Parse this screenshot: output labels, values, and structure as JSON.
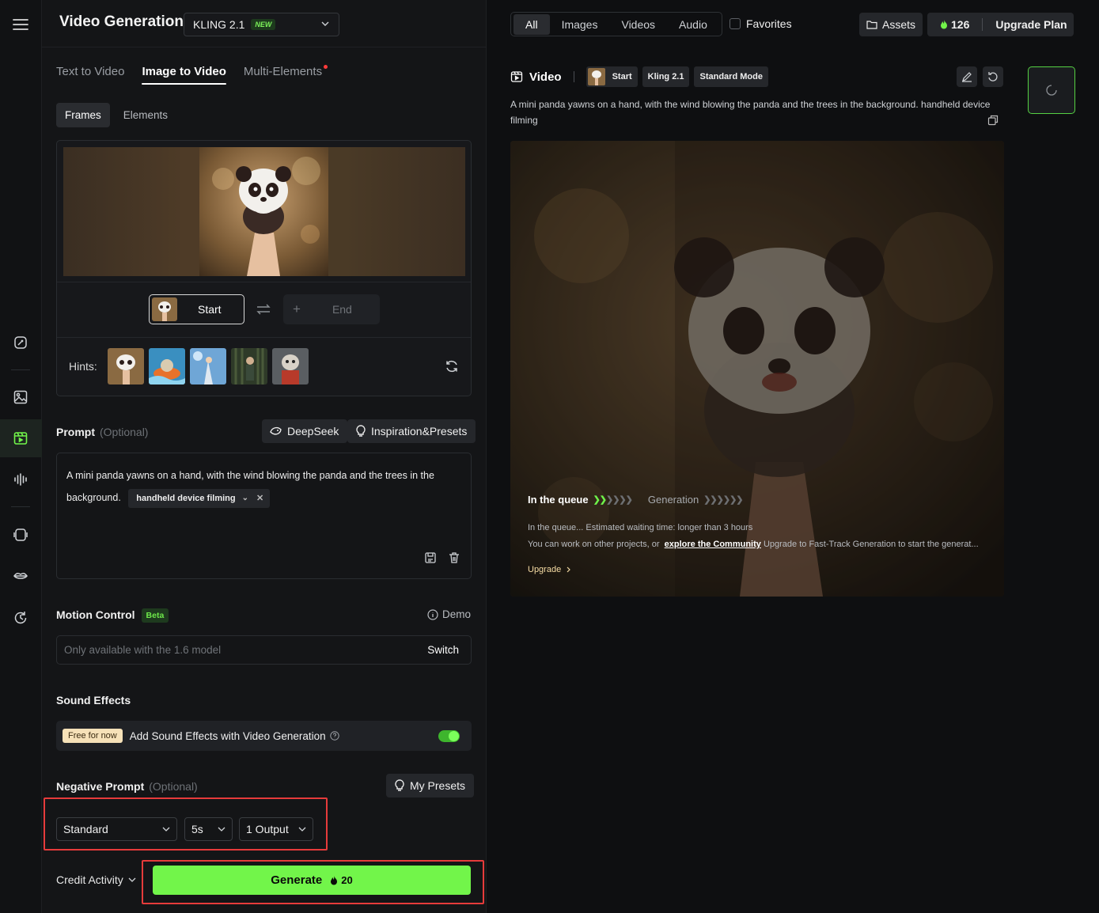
{
  "left": {
    "title": "Video Generation",
    "model": {
      "name": "KLING 2.1",
      "badge": "NEW"
    },
    "tabs": [
      {
        "label": "Text to Video"
      },
      {
        "label": "Image to Video"
      },
      {
        "label": "Multi-Elements"
      }
    ],
    "subtabs": [
      {
        "label": "Frames"
      },
      {
        "label": "Elements"
      }
    ],
    "frames": {
      "start_label": "Start",
      "end_label": "End",
      "hints_label": "Hints:"
    },
    "prompt": {
      "label": "Prompt",
      "optional": "(Optional)",
      "deepseek": "DeepSeek",
      "presets": "Inspiration&Presets",
      "text": "A mini panda yawns on a hand, with the wind blowing the panda and the trees in the background.",
      "chip": "handheld device filming"
    },
    "motion": {
      "label": "Motion Control",
      "beta": "Beta",
      "demo": "Demo",
      "placeholder": "Only available with the 1.6 model",
      "switch": "Switch"
    },
    "sound": {
      "label": "Sound Effects",
      "free": "Free for now",
      "text": "Add Sound Effects with Video Generation",
      "enabled": true
    },
    "negative": {
      "label": "Negative Prompt",
      "optional": "(Optional)",
      "presets": "My Presets"
    },
    "settings": {
      "mode": "Standard",
      "duration": "5s",
      "outputs": "1 Output"
    },
    "credit_activity": "Credit Activity",
    "generate": {
      "label": "Generate",
      "cost": "20"
    }
  },
  "right": {
    "filters": [
      {
        "label": "All"
      },
      {
        "label": "Images"
      },
      {
        "label": "Videos"
      },
      {
        "label": "Audio"
      }
    ],
    "favorites": "Favorites",
    "assets": "Assets",
    "credits": "126",
    "upgrade_plan": "Upgrade Plan",
    "video": {
      "title": "Video",
      "tags": [
        "Start",
        "Kling 2.1",
        "Standard Mode"
      ],
      "description": "A mini panda yawns on a hand, with the wind blowing the panda and the trees in the background. handheld device filming",
      "queue_label": "In the queue",
      "generation_label": "Generation",
      "queue_msg": "In the queue... Estimated waiting time: longer than 3 hours",
      "work_msg_a": "You can work on other projects, or",
      "community_link": "explore the Community",
      "work_msg_b": "Upgrade to Fast-Track Generation to start the generat...",
      "upgrade": "Upgrade"
    }
  },
  "colors": {
    "accent": "#72f54a",
    "highlight_box": "#e63b3b"
  },
  "icons": [
    "menu-icon",
    "magic-wand-icon",
    "image-icon",
    "video-icon",
    "audio-icon",
    "effects-icon",
    "lips-icon",
    "history-icon"
  ]
}
